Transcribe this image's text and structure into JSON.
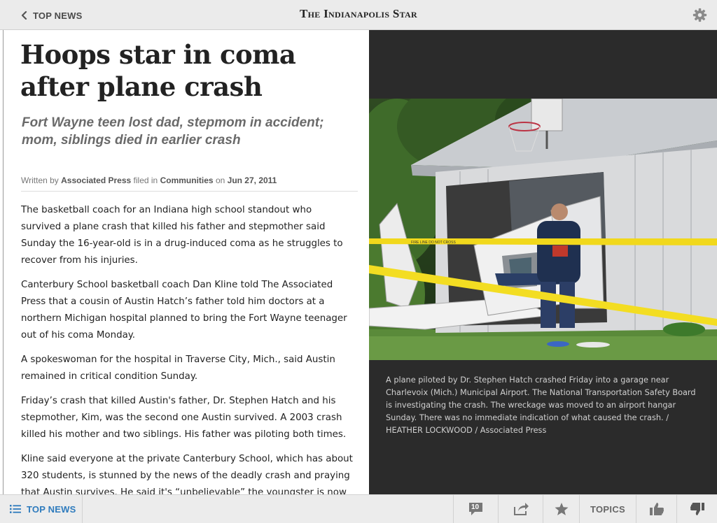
{
  "header": {
    "back_label": "TOP NEWS",
    "masthead": "The Indianapolis Star"
  },
  "article": {
    "headline": "Hoops star in coma after plane crash",
    "subheadline": "Fort Wayne teen lost dad, stepmom in accident; mom, siblings died in earlier crash",
    "byline": {
      "written_by_prefix": "Written by",
      "author": "Associated Press",
      "filed_in_prefix": "filed in",
      "section": "Communities",
      "on_prefix": "on",
      "date": "Jun 27, 2011"
    },
    "paragraphs": [
      "The basketball coach for an Indiana high school standout who survived a plane crash that killed his father and stepmother said Sunday the 16-year-old is in a drug-induced coma as he struggles to recover from his injuries.",
      "Canterbury School basketball coach Dan Kline told The Associated Press that a cousin of Austin Hatch’s father told him doctors at a northern Michigan hospital planned to bring the Fort Wayne teenager out of his coma Monday.",
      "A spokeswoman for the hospital in Traverse City, Mich., said Austin remained in critical condition Sunday.",
      "Friday’s crash that killed Austin's father, Dr. Stephen Hatch and his stepmother, Kim, was the second one Austin survived. A 2003 crash killed his mother and two siblings. His father was piloting both times.",
      "Kline said everyone at the private Canterbury School, which has about 320 students, is stunned by the news of the deadly crash and praying that Austin survives. He said it's “unbelievable” the youngster is now the"
    ]
  },
  "photo": {
    "caption": "A plane piloted by Dr. Stephen Hatch crashed Friday into a garage near Charlevoix (Mich.) Municipal Airport. The National Transportation Safety Board is investigating the crash. The wreckage was moved to an airport hangar Sunday. There was no immediate indication of what caused the crash. / HEATHER LOCKWOOD / Associated Press",
    "tape_text": "FIRE LINE DO NOT CROSS"
  },
  "footer": {
    "top_news_label": "TOP NEWS",
    "comment_count": "10",
    "topics_label": "TOPICS"
  },
  "icons": {
    "back": "chevron-left-icon",
    "settings": "gear-icon",
    "list": "list-icon",
    "comments": "comment-bubble-icon",
    "share": "share-icon",
    "favorite": "star-icon",
    "like": "thumbs-up-icon",
    "dislike": "thumbs-down-icon"
  },
  "colors": {
    "accent": "#2e7bbd",
    "bar_background": "#ebebeb",
    "media_background": "#2b2b2b"
  }
}
